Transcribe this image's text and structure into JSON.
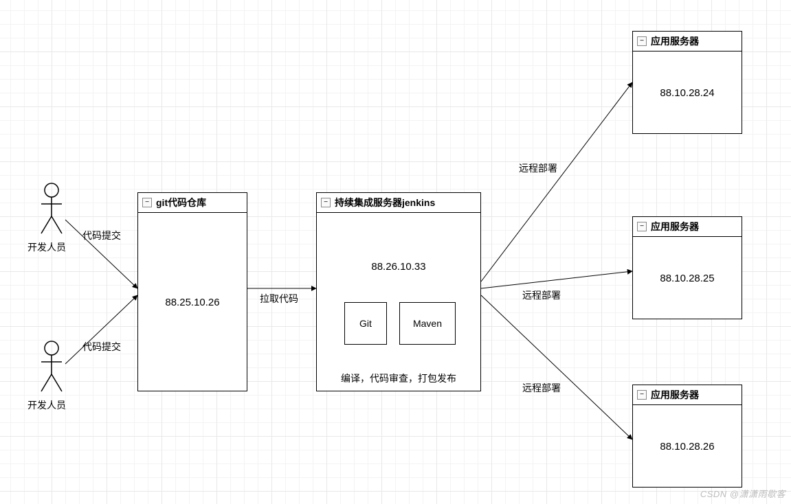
{
  "actors": [
    {
      "label": "开发人员",
      "edge_label": "代码提交"
    },
    {
      "label": "开发人员",
      "edge_label": "代码提交"
    }
  ],
  "git_repo": {
    "title": "git代码仓库",
    "ip": "88.25.10.26"
  },
  "pull_label": "拉取代码",
  "ci_server": {
    "title": "持续集成服务器jenkins",
    "ip": "88.26.10.33",
    "tools": [
      "Git",
      "Maven"
    ],
    "caption": "编译，代码审查，打包发布"
  },
  "deploy_label": "远程部署",
  "app_servers": [
    {
      "title": "应用服务器",
      "ip": "88.10.28.24"
    },
    {
      "title": "应用服务器",
      "ip": "88.10.28.25"
    },
    {
      "title": "应用服务器",
      "ip": "88.10.28.26"
    }
  ],
  "watermark": "CSDN @潇潇雨歇客",
  "collapse_glyph": "−"
}
